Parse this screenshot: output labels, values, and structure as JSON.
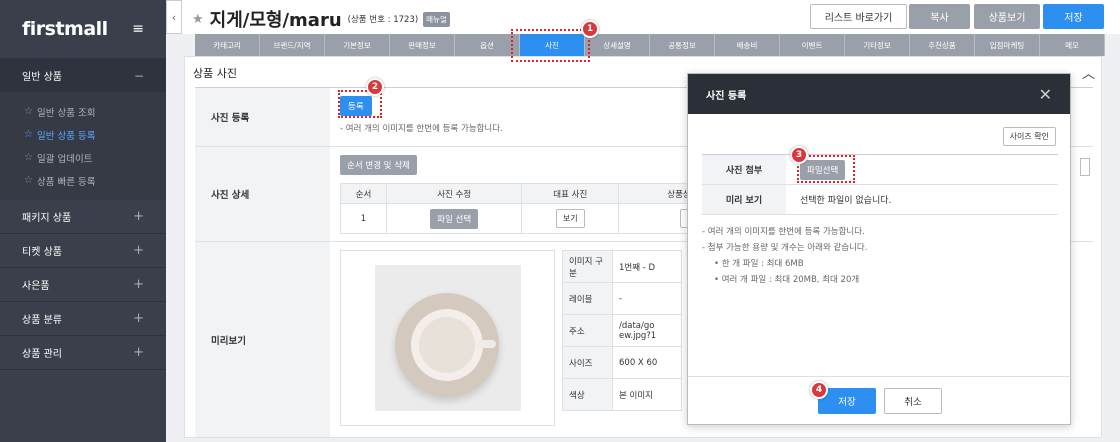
{
  "sidebar": {
    "logo": "firstmall",
    "hamburger_icon": "≡",
    "section_open": {
      "label": "일반 상품",
      "sign": "−"
    },
    "sub_items": [
      {
        "label": "일반 상품 조회",
        "active": false
      },
      {
        "label": "일반 상품 등록",
        "active": true
      },
      {
        "label": "일괄 업데이트",
        "active": false
      },
      {
        "label": "상품 빠른 등록",
        "active": false
      }
    ],
    "items": [
      {
        "label": "패키지 상품",
        "sign": "+"
      },
      {
        "label": "티켓 상품",
        "sign": "+"
      },
      {
        "label": "사은품",
        "sign": "+"
      },
      {
        "label": "상품 분류",
        "sign": "+"
      },
      {
        "label": "상품 관리",
        "sign": "+"
      }
    ]
  },
  "header": {
    "title": "지게/모형/maru",
    "product_no": "(상품 번호 : 1723)",
    "badge": "매뉴얼",
    "btn_list": "리스트 바로가기",
    "btn_copy": "복사",
    "btn_view": "상품보기",
    "btn_save": "저장"
  },
  "tabs": [
    "카테고리",
    "브랜드/지역",
    "기본정보",
    "판매정보",
    "옵션",
    "사진",
    "상세설명",
    "공통정보",
    "배송비",
    "이벤트",
    "기타정보",
    "추천상품",
    "입점마케팅",
    "메모"
  ],
  "active_tab_index": 5,
  "panel": {
    "title": "상품 사진",
    "row_register": {
      "label": "사진 등록",
      "button": "등록",
      "note": "- 여러 개의 이미지를 한번에 등록 가능합니다."
    },
    "row_detail": {
      "label": "사진 상세",
      "reorder_button": "순서 변경 및 삭제",
      "headers": [
        "순서",
        "사진 수정",
        "대표 사진",
        "상품상세(확대)"
      ],
      "row": {
        "order": "1",
        "edit": "파일 선택",
        "rep": "보기",
        "detail": "보기"
      }
    },
    "row_preview": {
      "label": "미리보기",
      "info": [
        {
          "k": "이미지 구분",
          "v": "1번째 - D"
        },
        {
          "k": "레이블",
          "v": "-"
        },
        {
          "k": "주소",
          "v": "/data/go ew.jpg?1"
        },
        {
          "k": "사이즈",
          "v": "600 X 60"
        },
        {
          "k": "색상",
          "v": "본 이미지"
        }
      ]
    }
  },
  "modal": {
    "title": "사진 등록",
    "close_icon": "✕",
    "size_check": "사이즈 확인",
    "attach_label": "사진 첨부",
    "attach_button": "파일선택",
    "preview_label": "미리 보기",
    "preview_value": "선택한 파일이 없습니다.",
    "notes": [
      "- 여러 개의 이미지를 한번에 등록 가능합니다.",
      "- 첨부 가능한 용량 및 개수는 아래와 같습니다.",
      "• 한 개 파일 : 최대 6MB",
      "• 여러 개 파일 : 최대 20MB, 최대 20개"
    ],
    "save": "저장",
    "cancel": "취소"
  },
  "callouts": [
    "1",
    "2",
    "3",
    "4"
  ]
}
